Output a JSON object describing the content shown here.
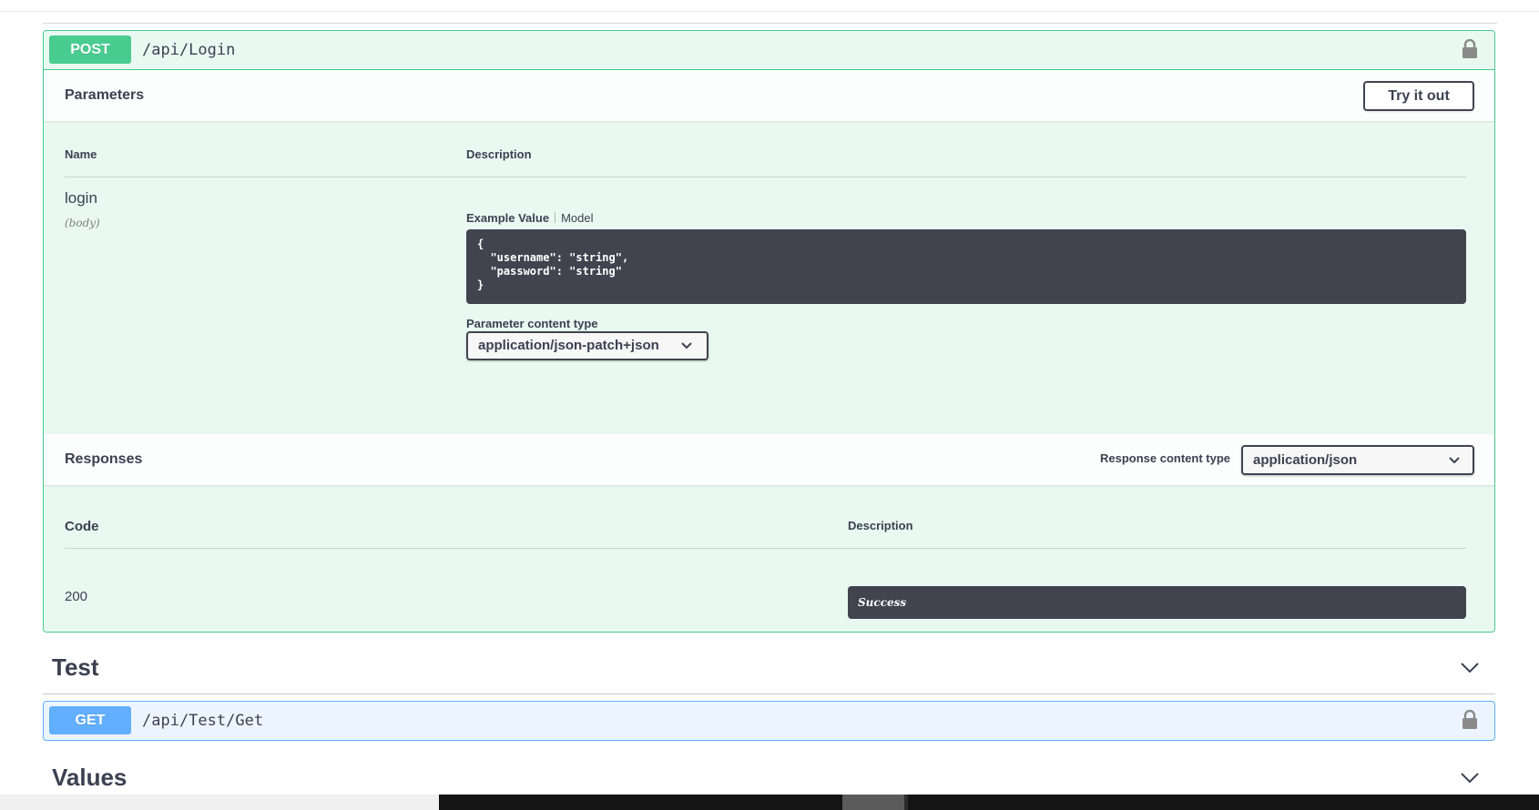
{
  "post_op": {
    "method": "POST",
    "path": "/api/Login",
    "parameters": {
      "title": "Parameters",
      "try_button": "Try it out",
      "col_name": "Name",
      "col_description": "Description",
      "param_name": "login",
      "param_in": "(body)",
      "tab_example": "Example Value",
      "tab_model": "Model",
      "example_json": "{\n  \"username\": \"string\",\n  \"password\": \"string\"\n}",
      "content_type_label": "Parameter content type",
      "content_type_value": "application/json-patch+json"
    },
    "responses": {
      "title": "Responses",
      "content_type_label": "Response content type",
      "content_type_value": "application/json",
      "col_code": "Code",
      "col_description": "Description",
      "rows": [
        {
          "code": "200",
          "description": "Success"
        }
      ]
    }
  },
  "tags": [
    {
      "name": "Test"
    },
    {
      "name": "Values"
    }
  ],
  "get_op": {
    "method": "GET",
    "path": "/api/Test/Get"
  },
  "colors": {
    "post": "#49cc90",
    "get": "#61affe",
    "dark": "#41444e",
    "text": "#3b4151"
  }
}
